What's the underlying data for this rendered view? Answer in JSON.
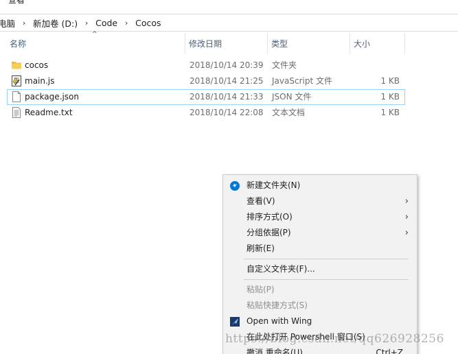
{
  "ribbon": {
    "tab_label": "查看"
  },
  "breadcrumb": {
    "items": [
      "电脑",
      "新加卷 (D:)",
      "Code",
      "Cocos"
    ],
    "separator": "›"
  },
  "columns": {
    "name": "名称",
    "date": "修改日期",
    "type": "类型",
    "size": "大小"
  },
  "files": [
    {
      "name": "cocos",
      "date": "2018/10/14 20:39",
      "type": "文件夹",
      "size": "",
      "icon": "folder-icon"
    },
    {
      "name": "main.js",
      "date": "2018/10/14 21:25",
      "type": "JavaScript 文件",
      "size": "1 KB",
      "icon": "js-file-icon"
    },
    {
      "name": "package.json",
      "date": "2018/10/14 21:33",
      "type": "JSON 文件",
      "size": "1 KB",
      "icon": "document-icon"
    },
    {
      "name": "Readme.txt",
      "date": "2018/10/14 22:08",
      "type": "文本文档",
      "size": "1 KB",
      "icon": "text-file-icon"
    }
  ],
  "context_menu": {
    "new_folder": "新建文件夹(N)",
    "view": "查看(V)",
    "sort_by": "排序方式(O)",
    "group_by": "分组依据(P)",
    "refresh": "刷新(E)",
    "customize_folder": "自定义文件夹(F)...",
    "paste": "粘贴(P)",
    "paste_shortcut": "粘贴快捷方式(S)",
    "open_with_wing": "Open with Wing",
    "open_powershell": "在此处打开 Powershell 窗口(S)",
    "undo_rename": "撤消 重命名(U)",
    "undo_shortcut": "Ctrl+Z",
    "submenu_arrow": "›"
  },
  "watermark": "https://blog.csdn.net/qq626928256",
  "colors": {
    "accent": "#0078d7",
    "header_text": "#4c607a",
    "focus_border": "#99d1ff",
    "folder": "#e8b73a",
    "menu_bg": "#f2f2f2"
  }
}
